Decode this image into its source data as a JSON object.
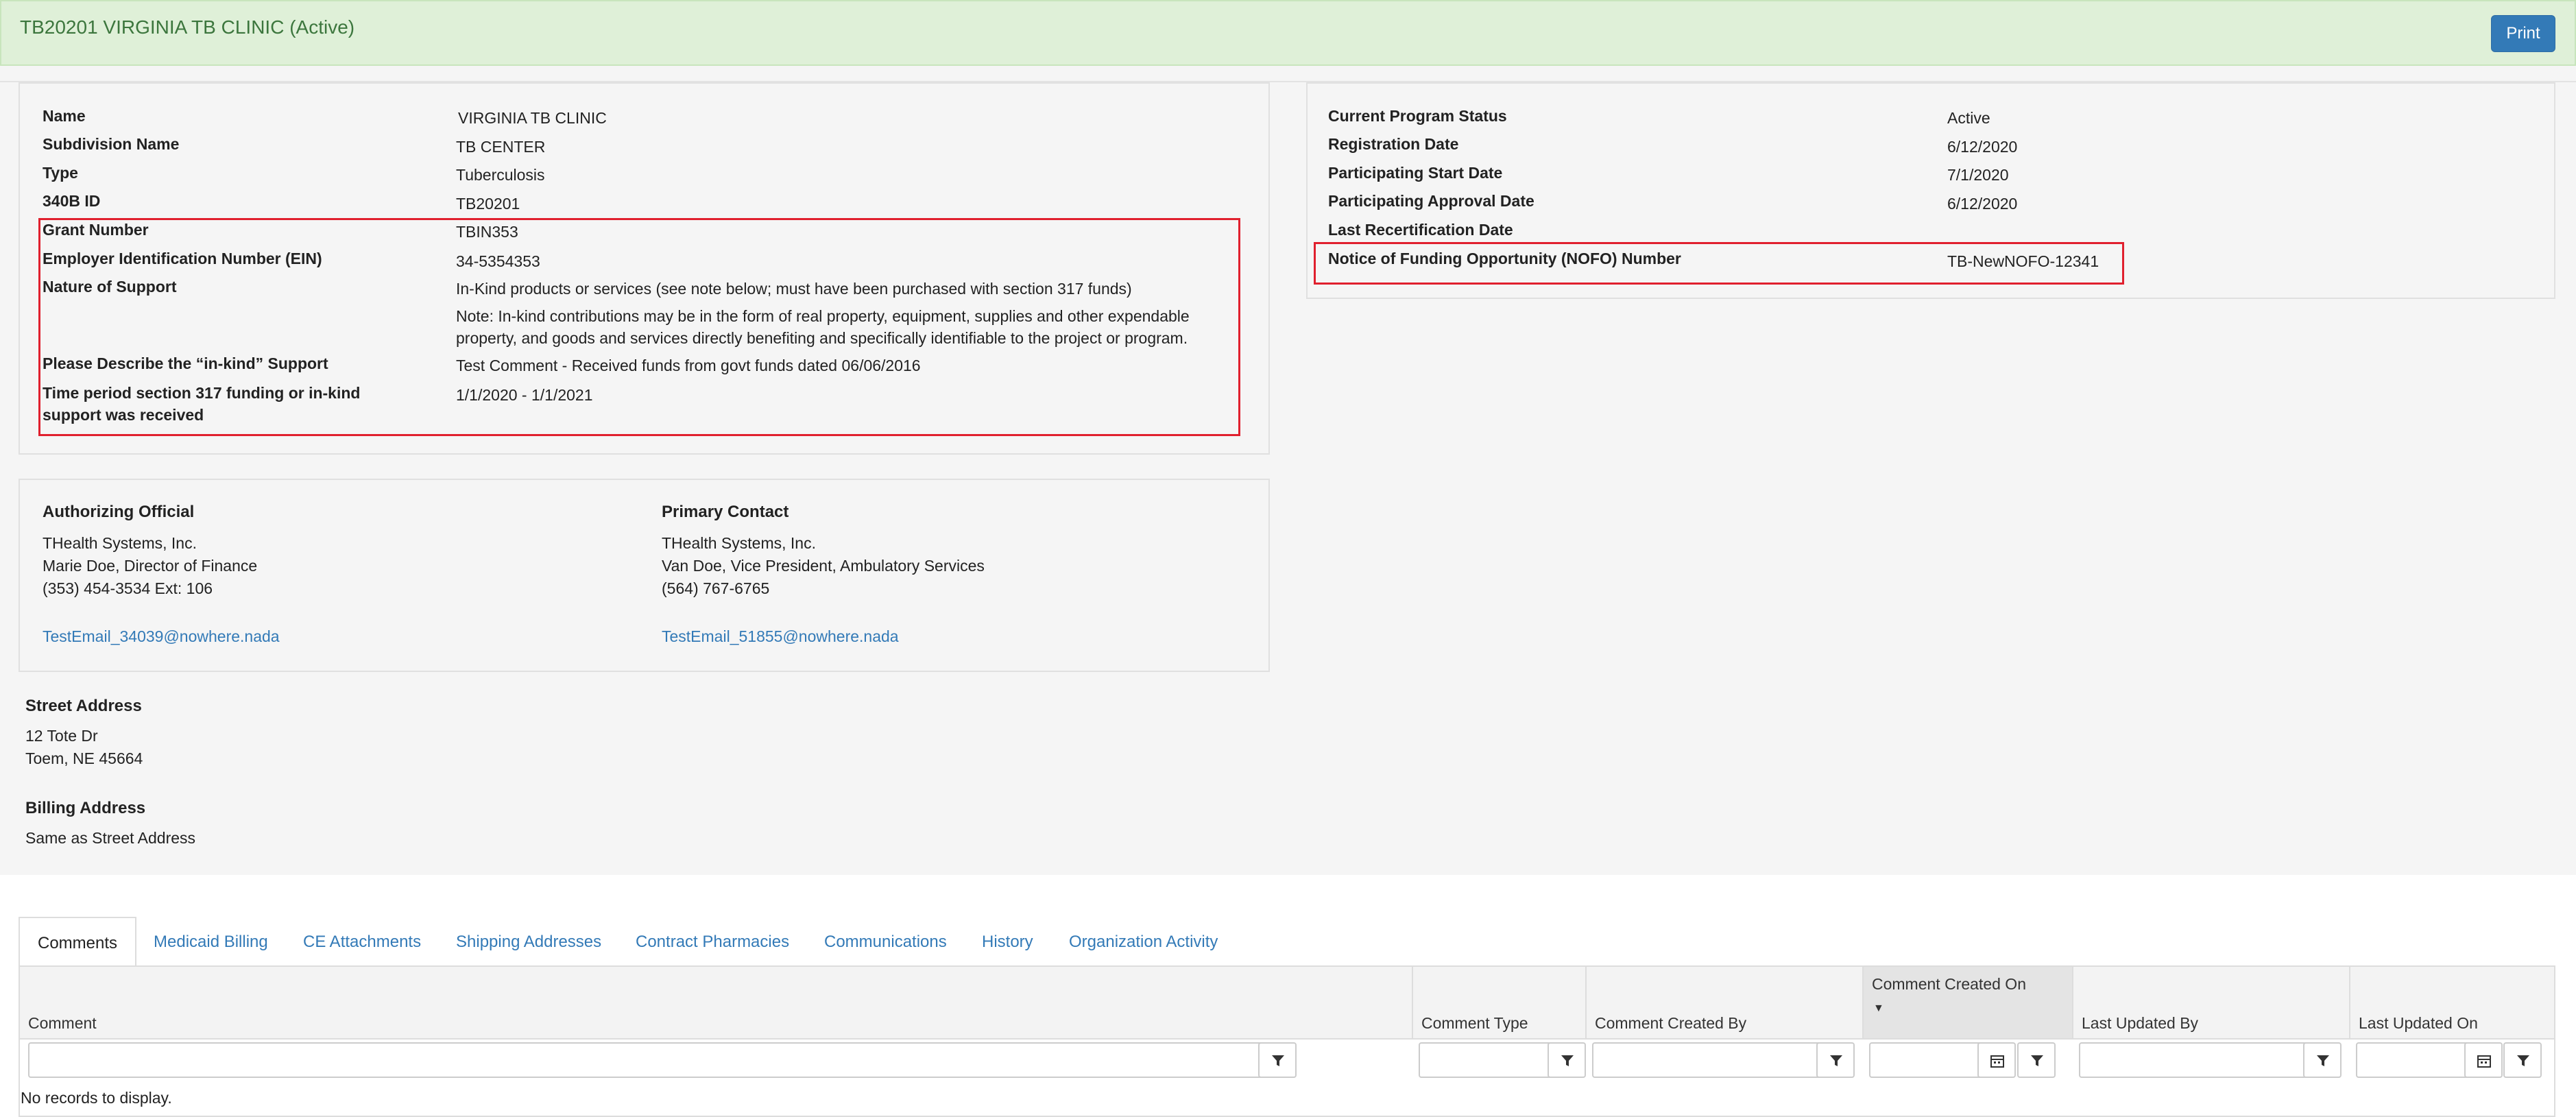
{
  "header": {
    "title": "TB20201 VIRGINIA TB CLINIC (Active)",
    "print_label": "Print"
  },
  "info_left": [
    {
      "label": "Name",
      "value": "VIRGINIA TB CLINIC"
    },
    {
      "label": "Subdivision Name",
      "value": "TB CENTER"
    },
    {
      "label": "Type",
      "value": "Tuberculosis"
    },
    {
      "label": "340B ID",
      "value": "TB20201"
    },
    {
      "label": "Grant Number",
      "value": "TBIN353"
    },
    {
      "label": "Employer Identification Number (EIN)",
      "value": "34-5354353"
    },
    {
      "label": "Nature of Support",
      "value": "In-Kind products or services (see note below; must have been purchased with section 317 funds)"
    },
    {
      "label": "Please Describe the “in-kind” Support",
      "value": "Test Comment - Received funds from govt funds dated 06/06/2016"
    },
    {
      "label": "Time period section 317 funding or in-kind support was received",
      "value": "1/1/2020 - 1/1/2021"
    }
  ],
  "nature_note_line1": "Note: In-kind contributions may be in the form of real property, equipment, supplies and other expendable",
  "nature_note_line2": "property, and goods and services directly benefiting and specifically identifiable to the project or program.",
  "time_label_line1": "Time period section 317 funding or in-kind",
  "time_label_line2": "support was received",
  "info_right": [
    {
      "label": "Current Program Status",
      "value": "Active"
    },
    {
      "label": "Registration Date",
      "value": "6/12/2020"
    },
    {
      "label": "Participating Start Date",
      "value": "7/1/2020"
    },
    {
      "label": "Participating Approval Date",
      "value": "6/12/2020"
    },
    {
      "label": "Last Recertification Date",
      "value": ""
    },
    {
      "label": "Notice of Funding Opportunity (NOFO) Number",
      "value": "TB-NewNOFO-12341"
    }
  ],
  "authorizing": {
    "title": "Authorizing Official",
    "line1": "THealth Systems, Inc.",
    "line2": "Marie Doe, Director of Finance",
    "line3": "(353) 454-3534 Ext: 106",
    "email": "TestEmail_34039@nowhere.nada"
  },
  "primary": {
    "title": "Primary Contact",
    "line1": "THealth Systems, Inc.",
    "line2": "Van Doe, Vice President, Ambulatory Services",
    "line3": "(564) 767-6765",
    "email": "TestEmail_51855@nowhere.nada"
  },
  "street": {
    "title": "Street Address",
    "line1": "12 Tote Dr",
    "line2": "Toem, NE 45664"
  },
  "billing": {
    "title": "Billing Address",
    "line1": "Same as Street Address"
  },
  "tabs": [
    "Comments",
    "Medicaid Billing",
    "CE Attachments",
    "Shipping Addresses",
    "Contract Pharmacies",
    "Communications",
    "History",
    "Organization Activity"
  ],
  "grid": {
    "columns": [
      "Comment",
      "Comment Type",
      "Comment Created By",
      "Comment Created On",
      "Last Updated By",
      "Last Updated On"
    ],
    "sorted_column": "Comment Created On",
    "empty_text": "No records to display."
  },
  "colors": {
    "header_bg": "#dff0d8",
    "accent": "#337ab7",
    "highlight": "#e0202e"
  }
}
